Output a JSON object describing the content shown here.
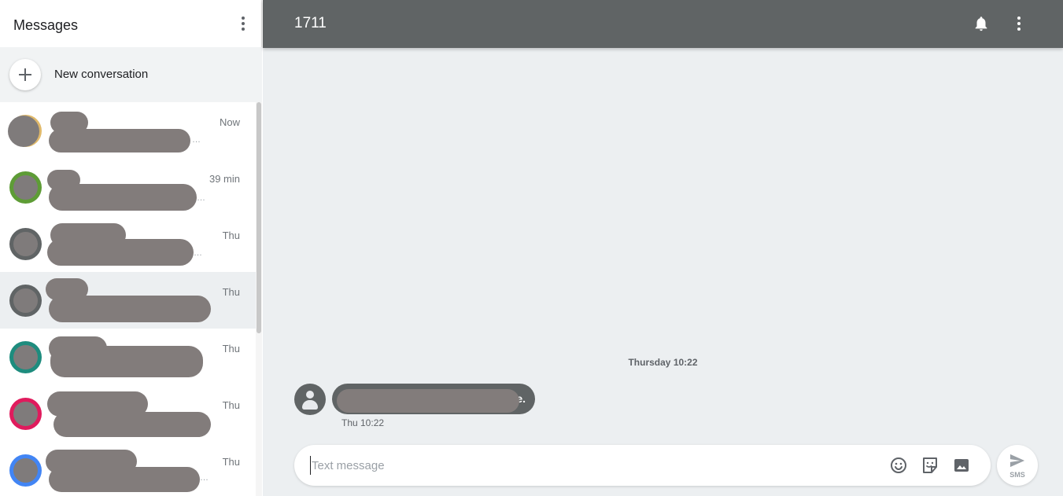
{
  "sidebar": {
    "title": "Messages",
    "new_conversation_label": "New conversation",
    "conversations": [
      {
        "time": "Now",
        "ring_color": "#e0b96a"
      },
      {
        "time": "39 min",
        "ring_color": "#5e9c36"
      },
      {
        "time": "Thu",
        "ring_color": "#606465"
      },
      {
        "time": "Thu",
        "ring_color": "#606465"
      },
      {
        "time": "Thu",
        "ring_color": "#1e8c7e"
      },
      {
        "time": "Thu",
        "ring_color": "#e01b5d"
      },
      {
        "time": "Thu",
        "ring_color": "#4285f4"
      }
    ]
  },
  "conversation": {
    "title": "1711",
    "date_divider": "Thursday 10:22",
    "message": {
      "visible_text_end": "e.",
      "timestamp": "Thu 10:22"
    }
  },
  "compose": {
    "placeholder": "Text message",
    "send_label": "SMS"
  },
  "icons": {
    "header": [
      "bell-icon",
      "more-vert-icon"
    ],
    "compose": [
      "emoji-icon",
      "sticker-icon",
      "image-icon",
      "send-icon"
    ]
  },
  "colors": {
    "header_bg": "#606465",
    "main_bg": "#eceff1",
    "selected_row": "#eceff1"
  }
}
